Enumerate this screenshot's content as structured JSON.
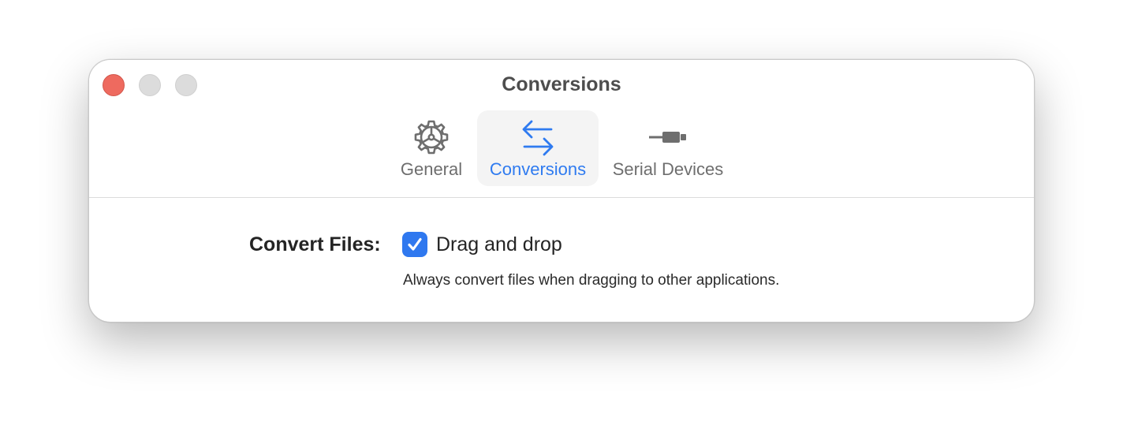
{
  "window": {
    "title": "Conversions"
  },
  "toolbar": {
    "tabs": [
      {
        "label": "General",
        "icon": "gear-icon",
        "selected": false
      },
      {
        "label": "Conversions",
        "icon": "arrows-left-right-icon",
        "selected": true
      },
      {
        "label": "Serial Devices",
        "icon": "serial-cable-icon",
        "selected": false
      }
    ]
  },
  "settings": {
    "convert_files": {
      "label": "Convert Files:",
      "checkbox_label": "Drag and drop",
      "checked": true,
      "hint": "Always convert files when dragging to other applications."
    }
  },
  "colors": {
    "accent": "#2f78ef",
    "close": "#ee6a5f",
    "inactive_button": "#dcdcdc"
  }
}
